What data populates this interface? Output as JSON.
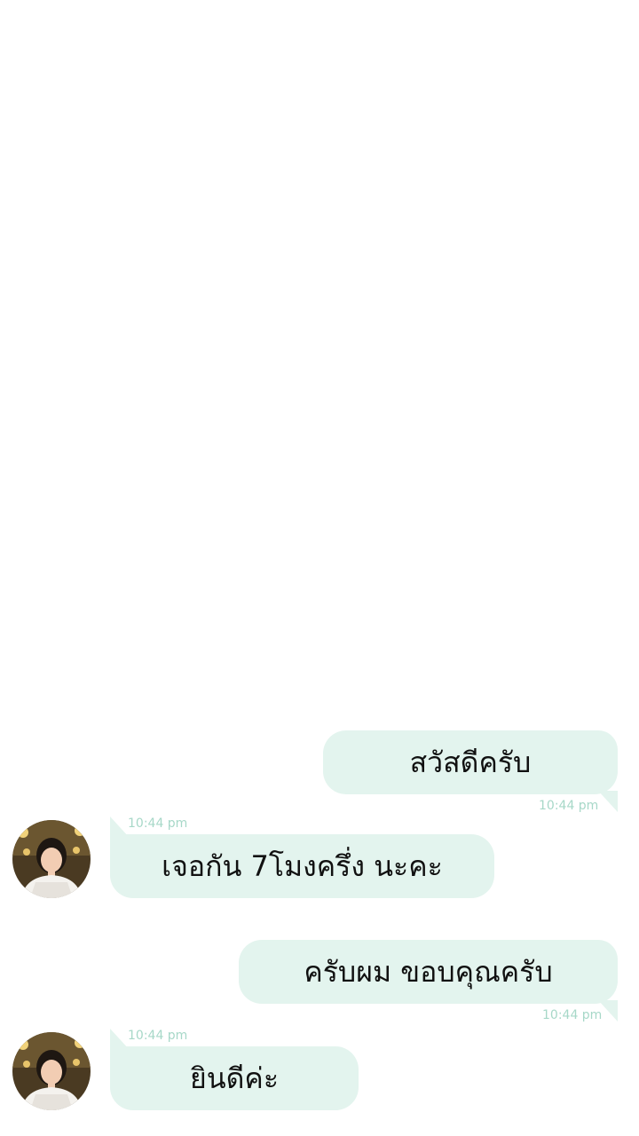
{
  "messages": [
    {
      "direction": "outgoing",
      "text": "สวัสดีครับ",
      "time": "10:44 pm"
    },
    {
      "direction": "incoming",
      "text": "เจอกัน 7โมงครึ่ง นะคะ",
      "time": "10:44 pm"
    },
    {
      "direction": "outgoing",
      "text": "ครับผม ขอบคุณครับ",
      "time": "10:44 pm"
    },
    {
      "direction": "incoming",
      "text": "ยินดีค่ะ",
      "time": "10:44 pm"
    }
  ],
  "colors": {
    "bubble": "#e3f4ee",
    "timestamp": "#a7d8c8",
    "text": "#111111",
    "background": "#ffffff"
  }
}
